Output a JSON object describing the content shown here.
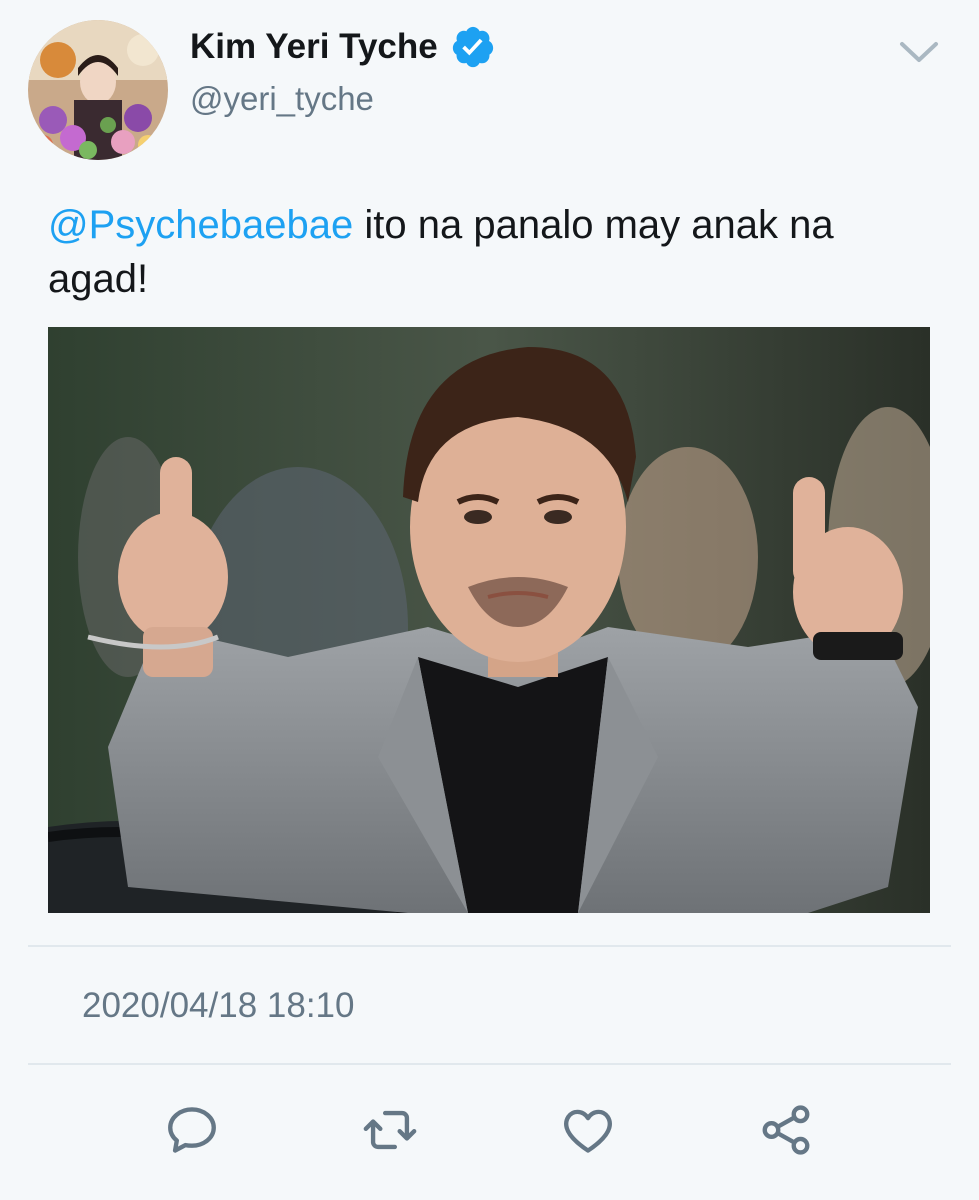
{
  "author": {
    "display_name": "Kim Yeri Tyche",
    "handle": "@yeri_tyche",
    "verified": true
  },
  "tweet": {
    "mention": "@Psychebaebae",
    "text": " ito na panalo may anak na agad!",
    "timestamp": "2020/04/18 18:10"
  },
  "actions": {
    "reply_icon": "reply-icon",
    "retweet_icon": "retweet-icon",
    "like_icon": "heart-icon",
    "share_icon": "share-icon"
  },
  "colors": {
    "accent": "#1da1f2",
    "secondary_text": "#657786",
    "primary_text": "#14171a",
    "background": "#f5f8fa",
    "divider": "#e1e8ed"
  }
}
